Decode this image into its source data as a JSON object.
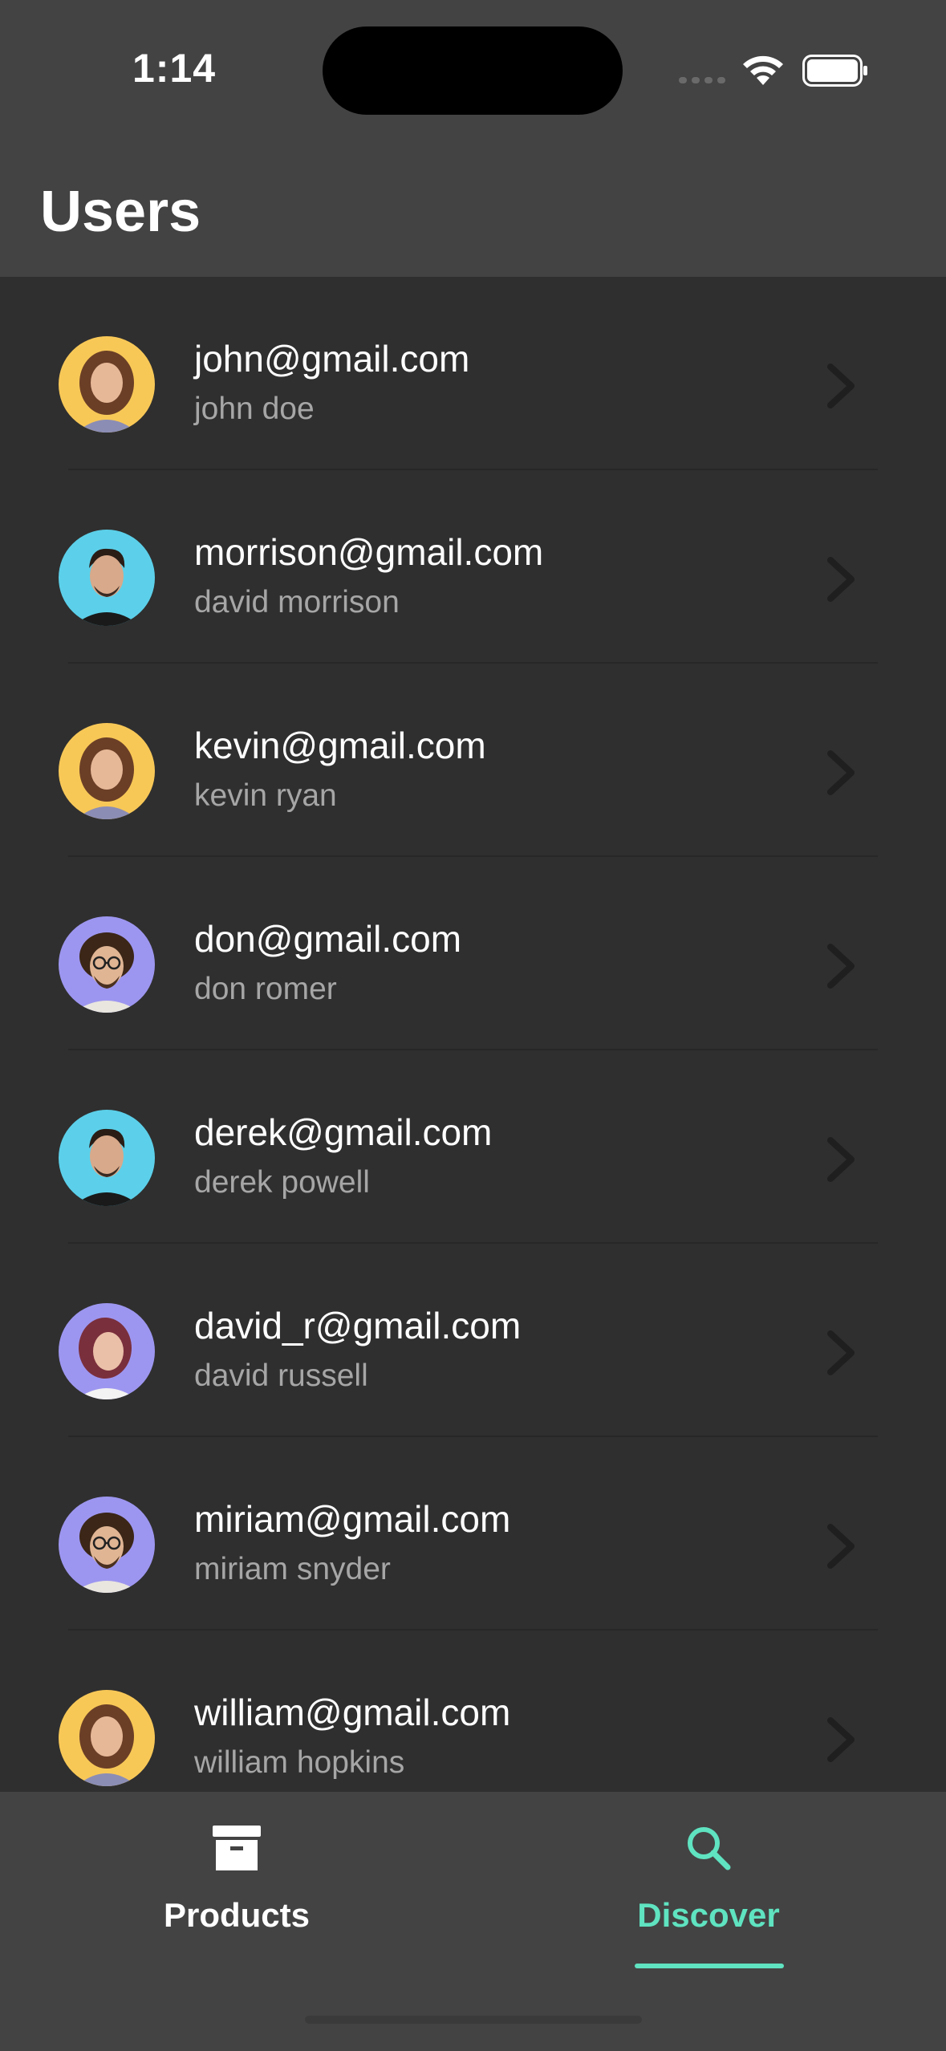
{
  "status_bar": {
    "time": "1:14"
  },
  "header": {
    "title": "Users"
  },
  "colors": {
    "background": "#2f2f2f",
    "header": "#434343",
    "accent": "#5fe3c0",
    "secondary_text": "#a6a6a6",
    "avatar_yellow": "#f8c857",
    "avatar_cyan": "#5cd0ea",
    "avatar_purple": "#9d96f0"
  },
  "users": [
    {
      "email": "john@gmail.com",
      "name": "john doe",
      "avatar": "woman-curly-avatar",
      "avatar_bg": "#f8c857"
    },
    {
      "email": "morrison@gmail.com",
      "name": "david morrison",
      "avatar": "man-dark-hair-avatar",
      "avatar_bg": "#5cd0ea"
    },
    {
      "email": "kevin@gmail.com",
      "name": "kevin ryan",
      "avatar": "woman-curly-avatar",
      "avatar_bg": "#f8c857"
    },
    {
      "email": "don@gmail.com",
      "name": "don romer",
      "avatar": "man-glasses-avatar",
      "avatar_bg": "#9d96f0"
    },
    {
      "email": "derek@gmail.com",
      "name": "derek powell",
      "avatar": "man-dark-hair-avatar",
      "avatar_bg": "#5cd0ea"
    },
    {
      "email": "david_r@gmail.com",
      "name": "david russell",
      "avatar": "woman-red-hair-avatar",
      "avatar_bg": "#9d96f0"
    },
    {
      "email": "miriam@gmail.com",
      "name": "miriam snyder",
      "avatar": "man-glasses-avatar",
      "avatar_bg": "#9d96f0"
    },
    {
      "email": "william@gmail.com",
      "name": "william hopkins",
      "avatar": "woman-curly-avatar",
      "avatar_bg": "#f8c857"
    }
  ],
  "bottom_nav": {
    "items": [
      {
        "label": "Products",
        "icon": "archive-box-icon",
        "active": false
      },
      {
        "label": "Discover",
        "icon": "search-icon",
        "active": true
      }
    ]
  }
}
